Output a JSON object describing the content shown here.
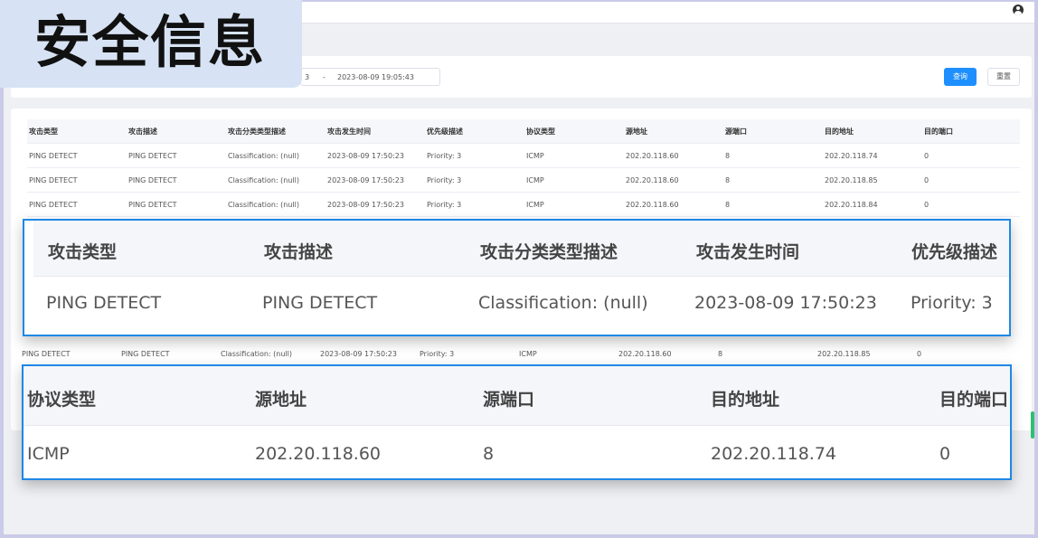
{
  "title_overlay": "安全信息",
  "filter": {
    "start_fragment": "3",
    "separator": "-",
    "end_datetime": "2023-08-09 19:05:43",
    "query_label": "查询",
    "reset_label": "重置"
  },
  "columns": [
    "攻击类型",
    "攻击描述",
    "攻击分类类型描述",
    "攻击发生时间",
    "优先级描述",
    "协议类型",
    "源地址",
    "源端口",
    "目的地址",
    "目的端口"
  ],
  "rows": [
    [
      "PING DETECT",
      "PING DETECT",
      "Classification: (null)",
      "2023-08-09 17:50:23",
      "Priority: 3",
      "ICMP",
      "202.20.118.60",
      "8",
      "202.20.118.74",
      "0"
    ],
    [
      "PING DETECT",
      "PING DETECT",
      "Classification: (null)",
      "2023-08-09 17:50:23",
      "Priority: 3",
      "ICMP",
      "202.20.118.60",
      "8",
      "202.20.118.85",
      "0"
    ],
    [
      "PING DETECT",
      "PING DETECT",
      "Classification: (null)",
      "2023-08-09 17:50:23",
      "Priority: 3",
      "ICMP",
      "202.20.118.60",
      "8",
      "202.20.118.84",
      "0"
    ]
  ],
  "lower_row": [
    "PING DETECT",
    "PING DETECT",
    "Classification: (null)",
    "2023-08-09 17:50:23",
    "Priority: 3",
    "ICMP",
    "202.20.118.60",
    "8",
    "202.20.118.85",
    "0"
  ],
  "zoom1": {
    "headers": [
      "攻击类型",
      "攻击描述",
      "攻击分类类型描述",
      "攻击发生时间",
      "优先级描述"
    ],
    "values": [
      "PING DETECT",
      "PING DETECT",
      "Classification: (null)",
      "2023-08-09 17:50:23",
      "Priority: 3"
    ]
  },
  "zoom2": {
    "headers": [
      "协议类型",
      "源地址",
      "源端口",
      "目的地址",
      "目的端口"
    ],
    "values": [
      "ICMP",
      "202.20.118.60",
      "8",
      "202.20.118.74",
      "0"
    ]
  },
  "icons": [
    "user-icon"
  ],
  "colors": {
    "accent": "#1e8fff",
    "highlight_border": "#1e88e5",
    "banner": "#d7e3f4"
  }
}
